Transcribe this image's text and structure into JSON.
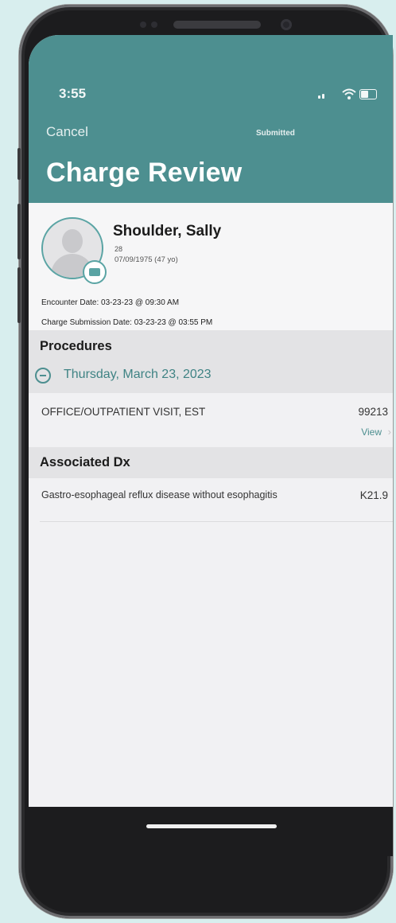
{
  "status_bar": {
    "time": "3:55"
  },
  "nav": {
    "cancel_label": "Cancel",
    "status_label": "Submitted",
    "page_title": "Charge Review"
  },
  "patient": {
    "name": "Shoulder, Sally",
    "age": "28",
    "dob": "07/09/1975 (47 yo)",
    "encounter_date": "Encounter Date: 03-23-23 @ 09:30 AM",
    "charge_submission_date": "Charge Submission Date:  03-23-23 @ 03:55 PM"
  },
  "procedures": {
    "section_label": "Procedures",
    "date_label": "Thursday, March 23, 2023",
    "items": [
      {
        "name": "OFFICE/OUTPATIENT VISIT, EST",
        "code": "99213",
        "view_label": "View"
      }
    ]
  },
  "associated_dx": {
    "section_label": "Associated Dx",
    "items": [
      {
        "name": "Gastro-esophageal reflux disease without esophagitis",
        "code": "K21.9"
      }
    ]
  },
  "colors": {
    "header": "#4d8f90",
    "accent": "#4d8f90",
    "section_bg": "#e3e3e5",
    "background": "#d8eeee"
  }
}
